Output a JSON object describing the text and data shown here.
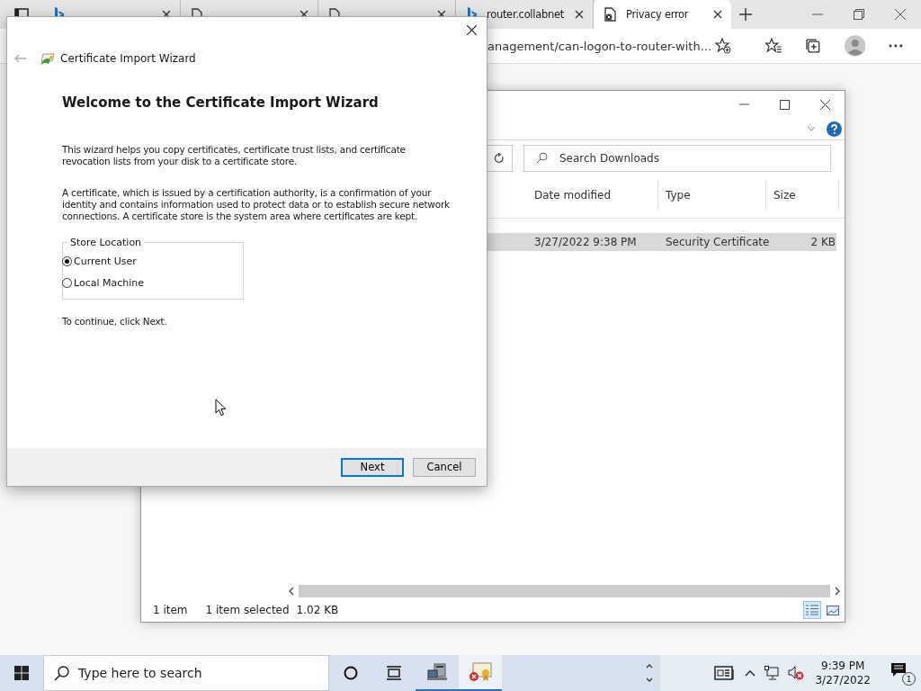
{
  "browser": {
    "tabs": [
      {
        "kind": "search",
        "selected": false
      },
      {
        "kind": "page",
        "selected": false
      },
      {
        "kind": "page",
        "selected": false
      },
      {
        "label": "router.collabnet",
        "kind": "search",
        "selected": false
      },
      {
        "label": "Privacy error",
        "kind": "error",
        "selected": true
      }
    ],
    "address": "anagement/can-logon-to-router-with..."
  },
  "explorer": {
    "search_placeholder": "Search Downloads",
    "columns": [
      "Date modified",
      "Type",
      "Size"
    ],
    "rows": [
      {
        "date": "3/27/2022 9:38 PM",
        "type": "Security Certificate",
        "size": "2 KB",
        "selected": true
      }
    ],
    "status": [
      "1 item",
      "1 item selected",
      "1.02 KB"
    ]
  },
  "dialog": {
    "title": "Certificate Import Wizard",
    "heading": "Welcome to the Certificate Import Wizard",
    "paragraphs": [
      "This wizard helps you copy certificates, certificate trust lists, and certificate revocation lists from your disk to a certificate store.",
      "A certificate, which is issued by a certification authority, is a confirmation of your identity and contains information used to protect data or to establish secure network connections. A certificate store is the system area where certificates are kept."
    ],
    "group_label": "Store Location",
    "options": [
      {
        "label": "Current User",
        "selected": true
      },
      {
        "label": "Local Machine",
        "selected": false
      }
    ],
    "continue_text": "To continue, click Next.",
    "buttons": [
      {
        "label": "Next",
        "default": true
      },
      {
        "label": "Cancel",
        "default": false
      }
    ]
  },
  "taskbar": {
    "search_placeholder": "Type here to search",
    "apps": [
      {
        "kind": "computer",
        "active": false
      },
      {
        "kind": "certificate",
        "active": true
      }
    ],
    "time": "9:39 PM",
    "date": "3/27/2022",
    "notification_count": "1"
  }
}
